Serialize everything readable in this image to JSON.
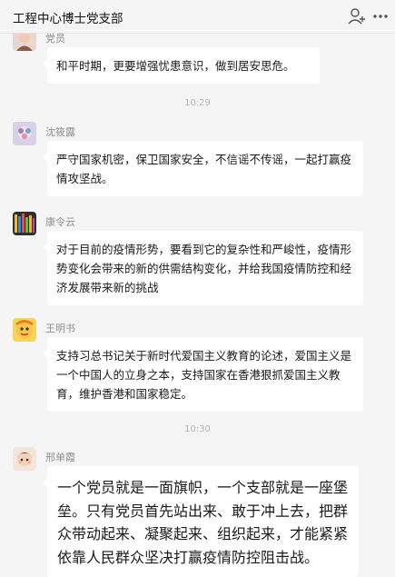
{
  "header": {
    "title": "工程中心博士党支部",
    "icons": [
      "add-member-icon",
      "more-icon"
    ]
  },
  "messages": [
    {
      "sender": "党员",
      "text": "和平时期，更要增强忧患意识，做到居安思危。"
    },
    {
      "time": "10:29"
    },
    {
      "sender": "沈筱露",
      "text": "严守国家机密，保卫国家安全，不信谣不传谣，一起打赢疫情攻坚战。"
    },
    {
      "sender": "康令云",
      "text": "对于目前的疫情形势，要看到它的复杂性和严峻性，疫情形势变化会带来的新的供需结构变化，并给我国疫情防控和经济发展带来新的挑战"
    },
    {
      "sender": "王明书",
      "text": "支持习总书记关于新时代爱国主义教育的论述，爱国主义是一个中国人的立身之本，支持国家在香港狠抓爱国主义教育，维护香港和国家稳定。"
    },
    {
      "time": "10:30"
    },
    {
      "sender": "邢单霞",
      "text": "一个党员就是一面旗帜，一个支部就是一座堡垒。只有党员首先站出来、敢于冲上去，把群众带动起来、凝聚起来、组织起来，才能紧紧依靠人民群众坚决打赢疫情防控阻击战。"
    }
  ]
}
